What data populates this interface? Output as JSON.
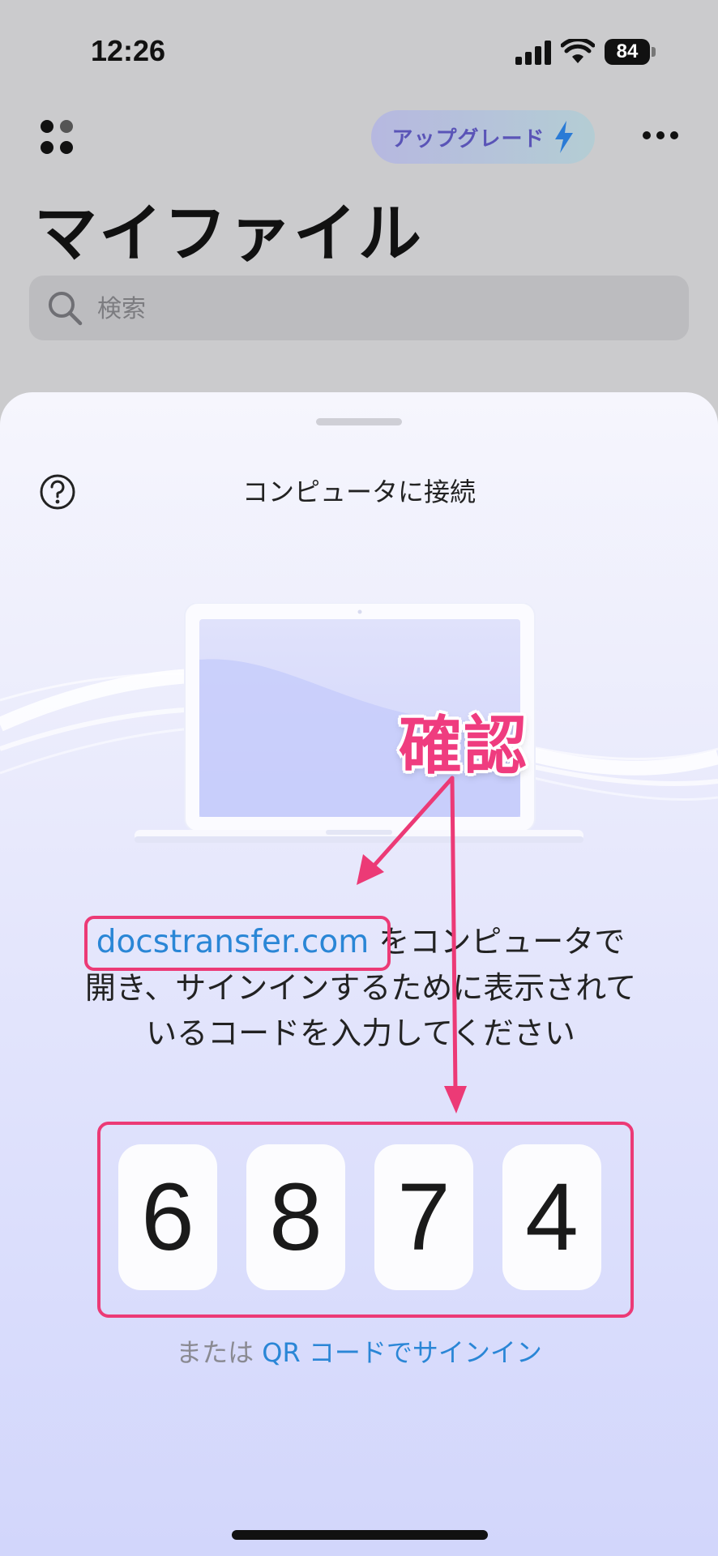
{
  "status_bar": {
    "time": "12:26",
    "battery": "84"
  },
  "header": {
    "upgrade_label": "アップグレード",
    "title": "マイファイル"
  },
  "search": {
    "placeholder": "検索"
  },
  "sheet": {
    "title": "コンピュータに接続",
    "instruction_link": "docstransfer.com",
    "instruction_text": "をコンピュータで開き、サインインするために表示されているコードを入力してください",
    "code": [
      "6",
      "8",
      "7",
      "4"
    ],
    "qr_prefix": "または",
    "qr_link": "QR コードでサインイン"
  },
  "annotation": {
    "note": "確認",
    "color": "#ec3a76"
  },
  "colors": {
    "accent_blue": "#2a86d6",
    "upgrade_text": "#5a54b7"
  },
  "icons": [
    "signal-icon",
    "wifi-icon",
    "battery-icon",
    "grid-icon",
    "bolt-icon",
    "more-icon",
    "search-icon",
    "help-icon",
    "laptop-illustration"
  ]
}
